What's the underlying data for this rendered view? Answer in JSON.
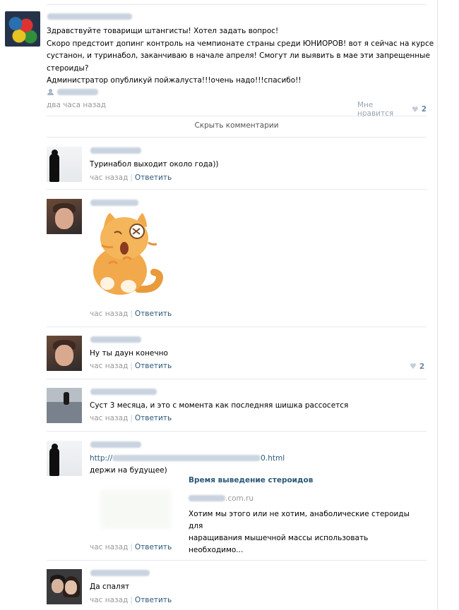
{
  "post": {
    "lines": [
      "Здравствуйте товарищи штангисты! Хотел задать вопрос!",
      "Скоро предстоит допинг контроль на чемпионате страны среди ЮНИОРОВ! вот я сейчас на курсе",
      "сустанон, и туринабол, заканчиваю в начале апреля! Смогут ли выявить в мае эти запрещенные",
      "стероиды?",
      "Администратор опубликуй пойжалуста!!!очень надо!!!спасибо!!"
    ],
    "date": "два часа назад",
    "like_label": "Мне нравится",
    "like_count": "2",
    "icons": {
      "signer": "person-icon",
      "like": "heart-icon"
    }
  },
  "hide_comments": "Скрыть комментарии",
  "comments": [
    {
      "text": "Туринабол выходит около года))",
      "time": "час назад",
      "reply": "Ответить"
    },
    {
      "text": "",
      "time": "час назад",
      "reply": "Ответить",
      "sticker": "crying-cat-sticker"
    },
    {
      "text": "Ну ты даун конечно",
      "time": "час назад",
      "reply": "Ответить",
      "likes": "2"
    },
    {
      "text": "Суст 3 месяца, и это с момента как последняя шишка рассосется",
      "time": "час назад",
      "reply": "Ответить"
    },
    {
      "link_prefix": "http://",
      "link_suffix": "0.html",
      "text": "держи на будущее)",
      "time": "час назад",
      "reply": "Ответить",
      "share": {
        "title": "Время выведение стероидов",
        "domain": ".com.ru",
        "desc_line1": "Хотим мы этого или не хотим, анаболические стероиды для",
        "desc_line2": "наращивания мышечной массы использовать необходимо..."
      }
    },
    {
      "text": "Да спалят",
      "time": "час назад",
      "reply": "Ответить"
    }
  ],
  "colors": {
    "link": "#2b587a",
    "muted": "#999999",
    "divider": "#e5e8ec"
  }
}
